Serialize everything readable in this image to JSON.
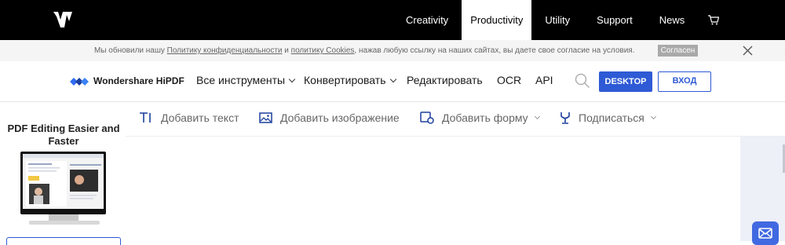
{
  "topnav": {
    "items": [
      "Creativity",
      "Productivity",
      "Utility",
      "Support",
      "News"
    ],
    "active": "Productivity",
    "cart_icon": "cart-icon",
    "logo_icon": "wondershare-logo"
  },
  "cookie": {
    "text_before": "Мы обновили нашу ",
    "link1": "Политику конфиденциальности",
    "text_middle": " и ",
    "link2": "политику Cookies",
    "text_after": ", нажав любую ссылку на наших сайтах, вы даете свое согласие на условия.",
    "agree_label": "Согласен",
    "close_icon": "close-icon"
  },
  "prodnav": {
    "brand": "Wondershare HiPDF",
    "items": [
      {
        "label": "Все инструменты",
        "dropdown": true
      },
      {
        "label": "Конвертировать",
        "dropdown": true
      },
      {
        "label": "Редактировать",
        "dropdown": false
      },
      {
        "label": "OCR",
        "dropdown": false
      },
      {
        "label": "API",
        "dropdown": false
      }
    ],
    "search_icon": "search-icon",
    "desktop_label": "DESKTOP",
    "login_label": "ВХОД",
    "accent": "#2e5ad5"
  },
  "toolbar": {
    "tools": [
      {
        "label": "Добавить текст",
        "icon": "text-icon",
        "dropdown": false
      },
      {
        "label": "Добавить изображение",
        "icon": "image-icon",
        "dropdown": false
      },
      {
        "label": "Добавить форму",
        "icon": "shape-icon",
        "dropdown": true
      },
      {
        "label": "Подписаться",
        "icon": "pen-icon",
        "dropdown": true
      }
    ]
  },
  "promo": {
    "title": "PDF Editing Easier and Faster"
  },
  "contact": {
    "icon": "mail-icon"
  }
}
